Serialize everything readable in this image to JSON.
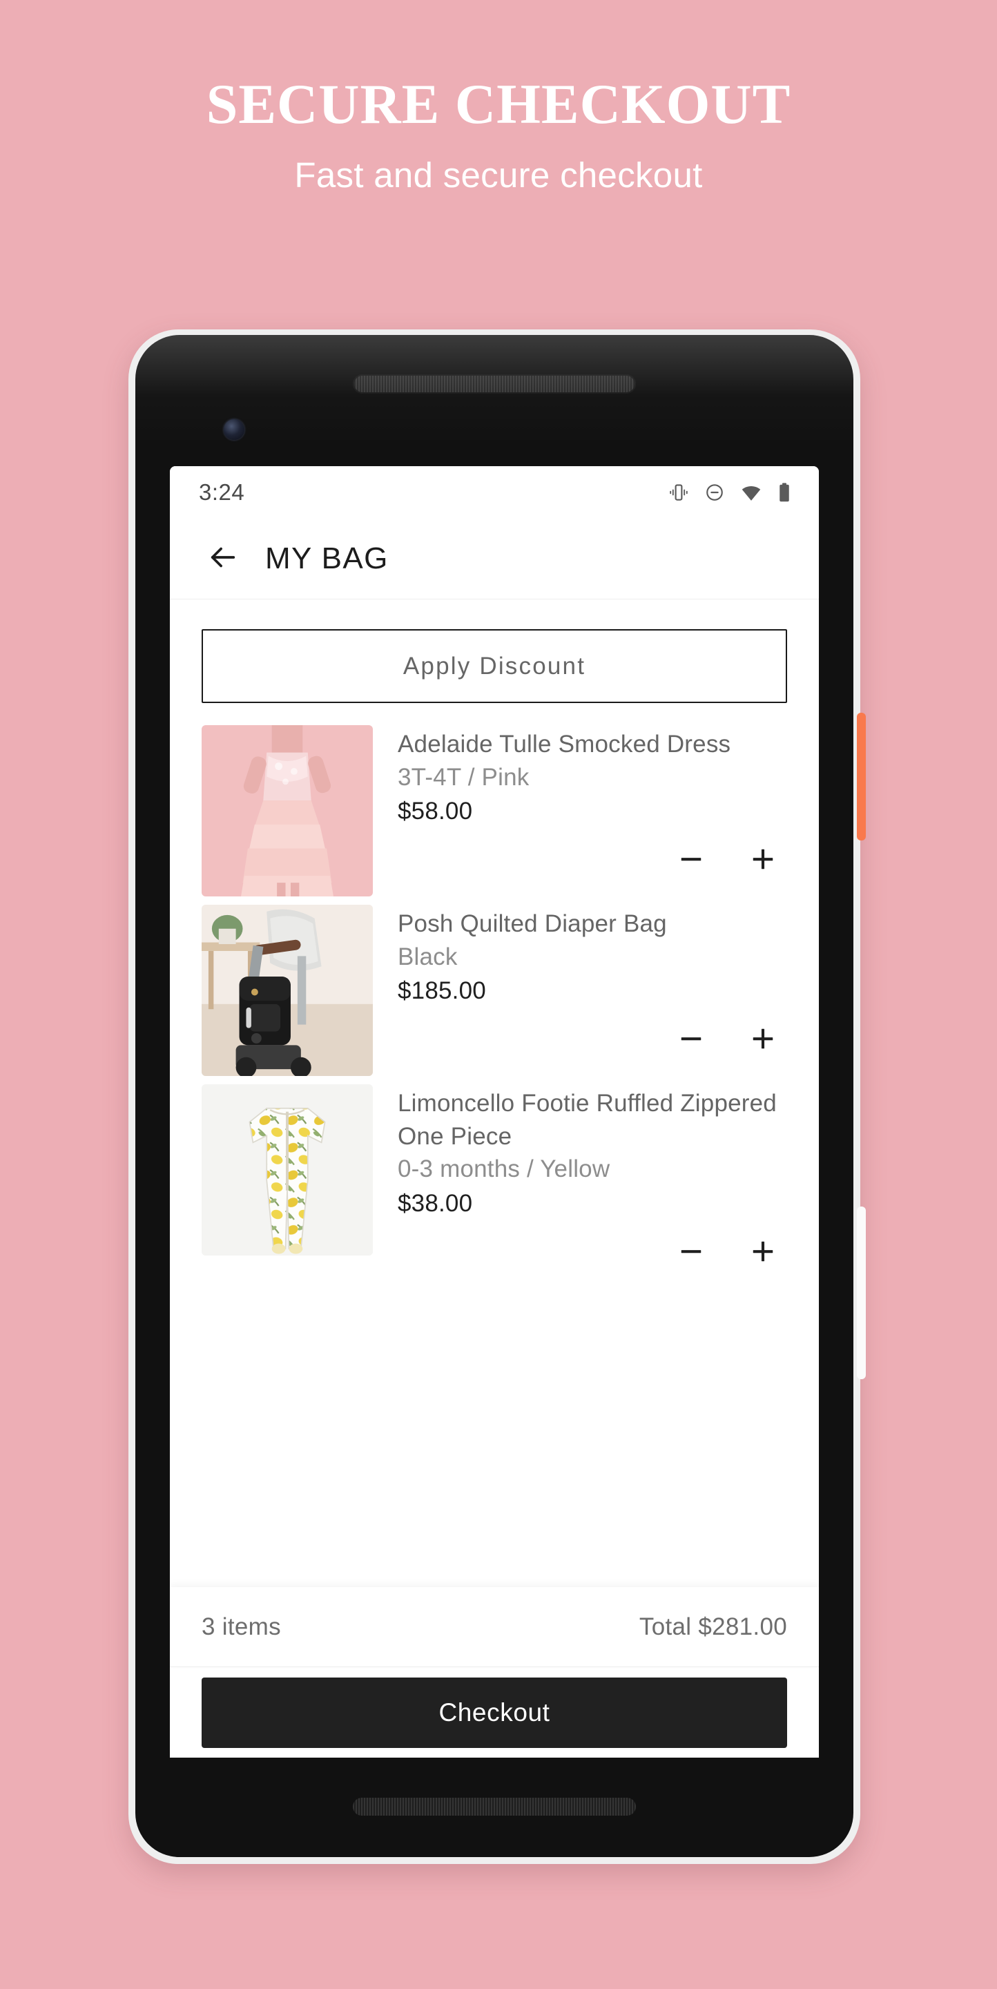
{
  "promo": {
    "title": "SECURE CHECKOUT",
    "subtitle": "Fast and secure checkout"
  },
  "phone": {
    "status_bar": {
      "time": "3:24",
      "icons": [
        "vibrate-icon",
        "do-not-disturb-icon",
        "wifi-icon",
        "battery-icon"
      ]
    },
    "app_bar": {
      "back_icon": "arrow-left-icon",
      "title": "MY BAG"
    },
    "discount": {
      "label": "Apply Discount"
    },
    "cart_items": [
      {
        "name": "Adelaide Tulle Smocked Dress",
        "variant": "3T-4T / Pink",
        "price": "$58.00",
        "decrease_label": "−",
        "increase_label": "+",
        "thumb": "pink-tulle-dress-photo"
      },
      {
        "name": "Posh Quilted Diaper Bag",
        "variant": "Black",
        "price": "$185.00",
        "decrease_label": "−",
        "increase_label": "+",
        "thumb": "black-diaper-bag-stroller-photo"
      },
      {
        "name": "Limoncello Footie Ruffled Zippered One Piece",
        "variant": "0-3 months / Yellow",
        "price": "$38.00",
        "decrease_label": "−",
        "increase_label": "+",
        "thumb": "lemon-print-footie-photo"
      }
    ],
    "totals": {
      "items_count": "3 items",
      "total_label": "Total",
      "total_amount": "$281.00"
    },
    "checkout": {
      "label": "Checkout"
    }
  },
  "colors": {
    "background_pink": "#edaeb5",
    "checkout_dark": "#212121",
    "power_button_orange": "#f9794d",
    "text_gray": "#656565"
  }
}
